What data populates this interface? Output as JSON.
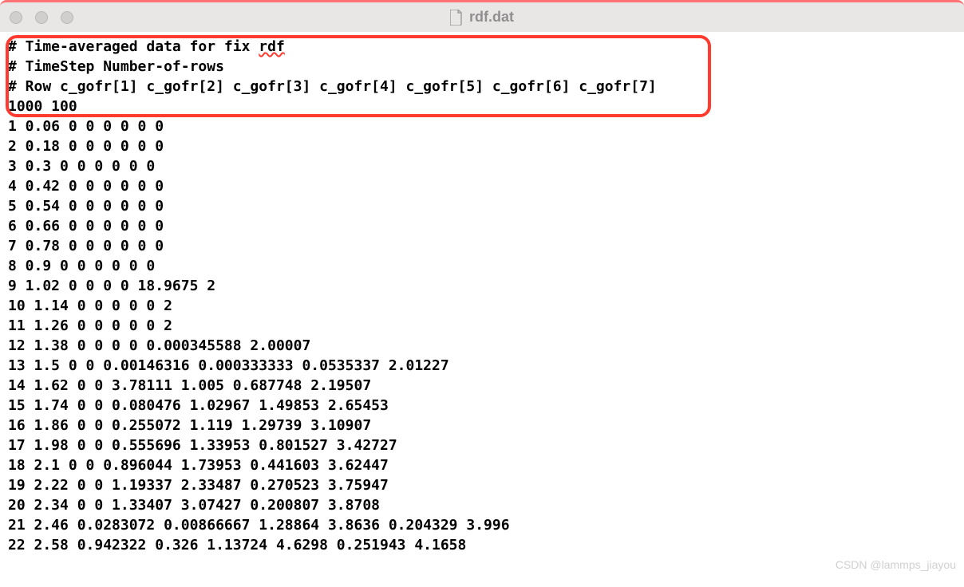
{
  "window": {
    "title": "rdf.dat"
  },
  "highlight": {
    "line1_pre": "# Time-averaged data for fix ",
    "line1_squiggle": "rdf",
    "line2": "# TimeStep Number-of-rows",
    "line3": "# Row c_gofr[1] c_gofr[2] c_gofr[3] c_gofr[4] c_gofr[5] c_gofr[6] c_gofr[7]",
    "line4": "1000 100"
  },
  "rows": [
    "1 0.06 0 0 0 0 0 0",
    "2 0.18 0 0 0 0 0 0",
    "3 0.3 0 0 0 0 0 0",
    "4 0.42 0 0 0 0 0 0",
    "5 0.54 0 0 0 0 0 0",
    "6 0.66 0 0 0 0 0 0",
    "7 0.78 0 0 0 0 0 0",
    "8 0.9 0 0 0 0 0 0",
    "9 1.02 0 0 0 0 18.9675 2",
    "10 1.14 0 0 0 0 0 2",
    "11 1.26 0 0 0 0 0 2",
    "12 1.38 0 0 0 0 0.000345588 2.00007",
    "13 1.5 0 0 0.00146316 0.000333333 0.0535337 2.01227",
    "14 1.62 0 0 3.78111 1.005 0.687748 2.19507",
    "15 1.74 0 0 0.080476 1.02967 1.49853 2.65453",
    "16 1.86 0 0 0.255072 1.119 1.29739 3.10907",
    "17 1.98 0 0 0.555696 1.33953 0.801527 3.42727",
    "18 2.1 0 0 0.896044 1.73953 0.441603 3.62447",
    "19 2.22 0 0 1.19337 2.33487 0.270523 3.75947",
    "20 2.34 0 0 1.33407 3.07427 0.200807 3.8708",
    "21 2.46 0.0283072 0.00866667 1.28864 3.8636 0.204329 3.996",
    "22 2.58 0.942322 0.326 1.13724 4.6298 0.251943 4.1658"
  ],
  "watermark": "CSDN @lammps_jiayou"
}
